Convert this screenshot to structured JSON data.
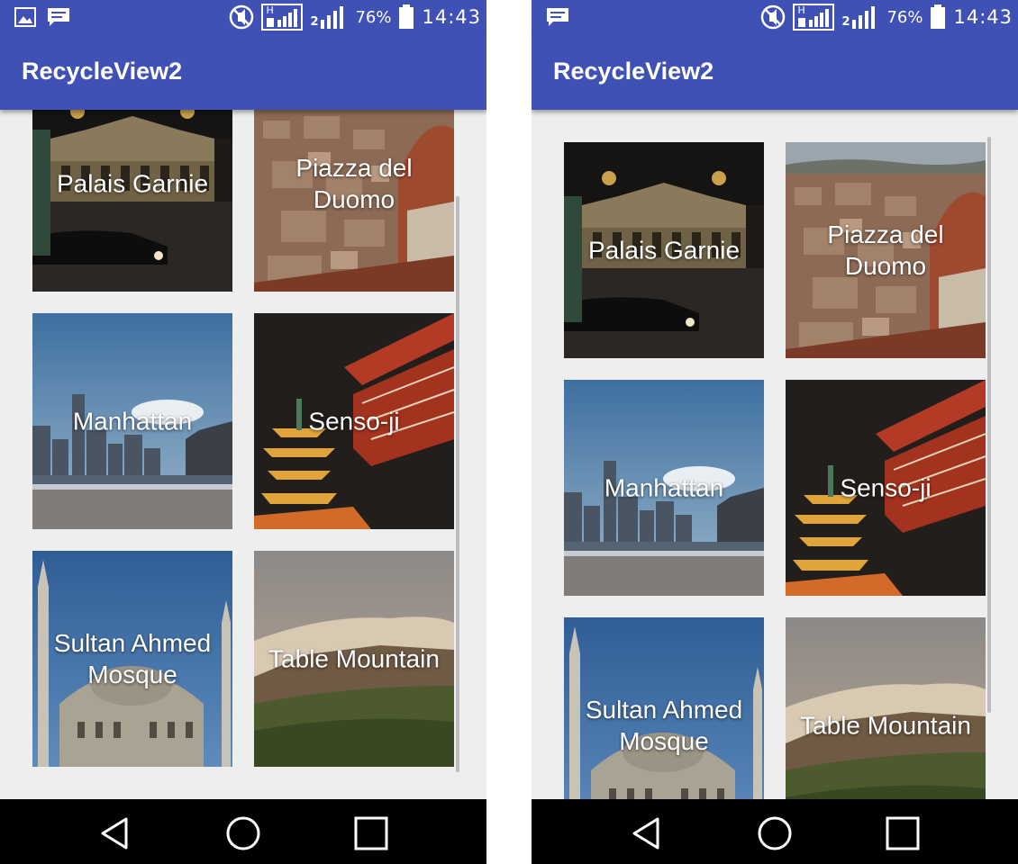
{
  "status_bar": {
    "battery": "76%",
    "time": "14:43",
    "sim1": "H",
    "sim2": "2",
    "icons": [
      "gallery-icon",
      "message-icon",
      "mute-icon",
      "signal-sim1-icon",
      "signal-sim2-icon",
      "battery-icon"
    ]
  },
  "app": {
    "title": "RecycleView2",
    "primary_color": "#3f51b5"
  },
  "cards": [
    {
      "label": "Palais Garnie"
    },
    {
      "label": "Piazza del Duomo"
    },
    {
      "label": "Manhattan"
    },
    {
      "label": "Senso-ji"
    },
    {
      "label": "Sultan Ahmed Mosque"
    },
    {
      "label": "Table Mountain"
    }
  ],
  "nav_bar": {
    "icons": [
      "back-icon",
      "home-icon",
      "recents-icon"
    ]
  }
}
